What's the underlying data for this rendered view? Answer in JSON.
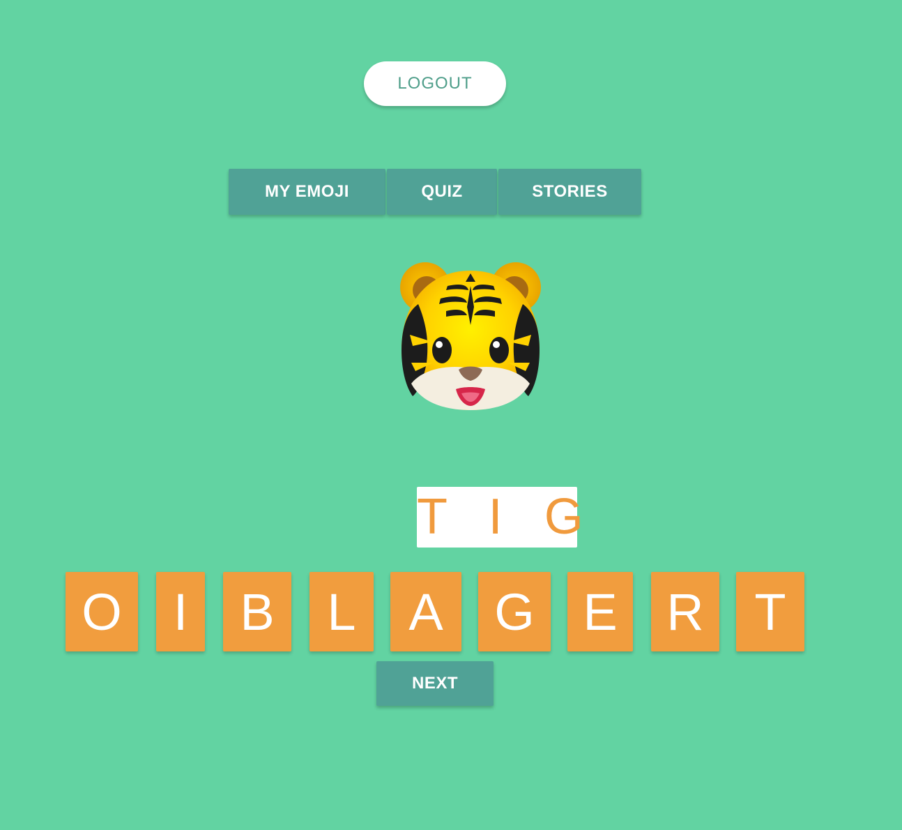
{
  "header": {
    "logout_label": "LOGOUT"
  },
  "nav": {
    "items": [
      {
        "label": "MY EMOJI"
      },
      {
        "label": "QUIZ"
      },
      {
        "label": "STORIES"
      }
    ]
  },
  "quiz": {
    "emoji_icon": "tiger-face-icon",
    "answer": "T I G",
    "letters": [
      "O",
      "I",
      "B",
      "L",
      "A",
      "G",
      "E",
      "R",
      "T"
    ],
    "next_label": "NEXT"
  },
  "colors": {
    "background": "#62d3a2",
    "nav_button": "#50a296",
    "tile": "#f19d3e",
    "answer_text": "#f09a3d",
    "logout_text": "#4f9e8a"
  }
}
